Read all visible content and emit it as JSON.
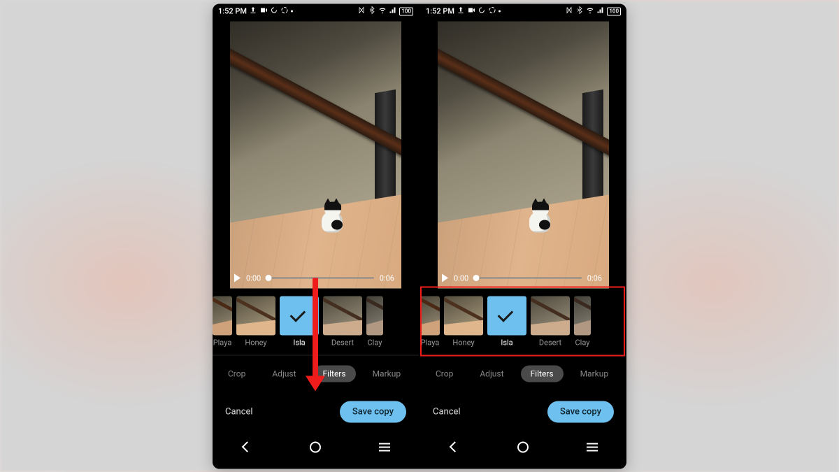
{
  "status": {
    "time": "1:52 PM",
    "battery": "100"
  },
  "video": {
    "current_time": "0:00",
    "duration": "0:06"
  },
  "filters": {
    "items": [
      {
        "label": "Playa"
      },
      {
        "label": "Honey"
      },
      {
        "label": "Isla"
      },
      {
        "label": "Desert"
      },
      {
        "label": "Clay"
      }
    ],
    "selected_index": 2
  },
  "tabs": {
    "items": [
      {
        "label": "Crop"
      },
      {
        "label": "Adjust"
      },
      {
        "label": "Filters"
      },
      {
        "label": "Markup"
      }
    ],
    "active_index": 2
  },
  "actions": {
    "cancel": "Cancel",
    "save": "Save copy"
  }
}
